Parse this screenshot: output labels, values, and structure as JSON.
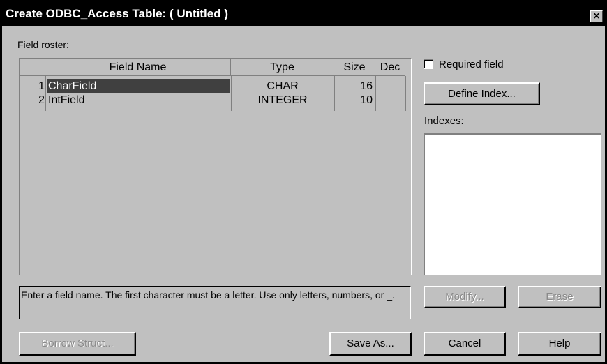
{
  "window": {
    "title": "Create ODBC_Access Table:  ( Untitled )",
    "close_glyph": "×"
  },
  "field_roster": {
    "label": "Field roster:",
    "columns": [
      "",
      "Field Name",
      "Type",
      "Size",
      "Dec"
    ],
    "rows": [
      {
        "num": "1",
        "name": "CharField",
        "type": "CHAR",
        "size": "16",
        "dec": ""
      },
      {
        "num": "2",
        "name": "IntField",
        "type": "INTEGER",
        "size": "10",
        "dec": ""
      }
    ]
  },
  "required_field": {
    "label": "Required field",
    "checked": false
  },
  "buttons": {
    "define_index": "Define Index...",
    "modify": "Modify...",
    "erase": "Erase",
    "borrow_struct": "Borrow Struct...",
    "save_as": "Save As...",
    "cancel": "Cancel",
    "help": "Help"
  },
  "indexes": {
    "label": "Indexes:",
    "items": []
  },
  "status": {
    "message": "Enter a field name. The first character must be a letter. Use only letters, numbers, or _."
  }
}
